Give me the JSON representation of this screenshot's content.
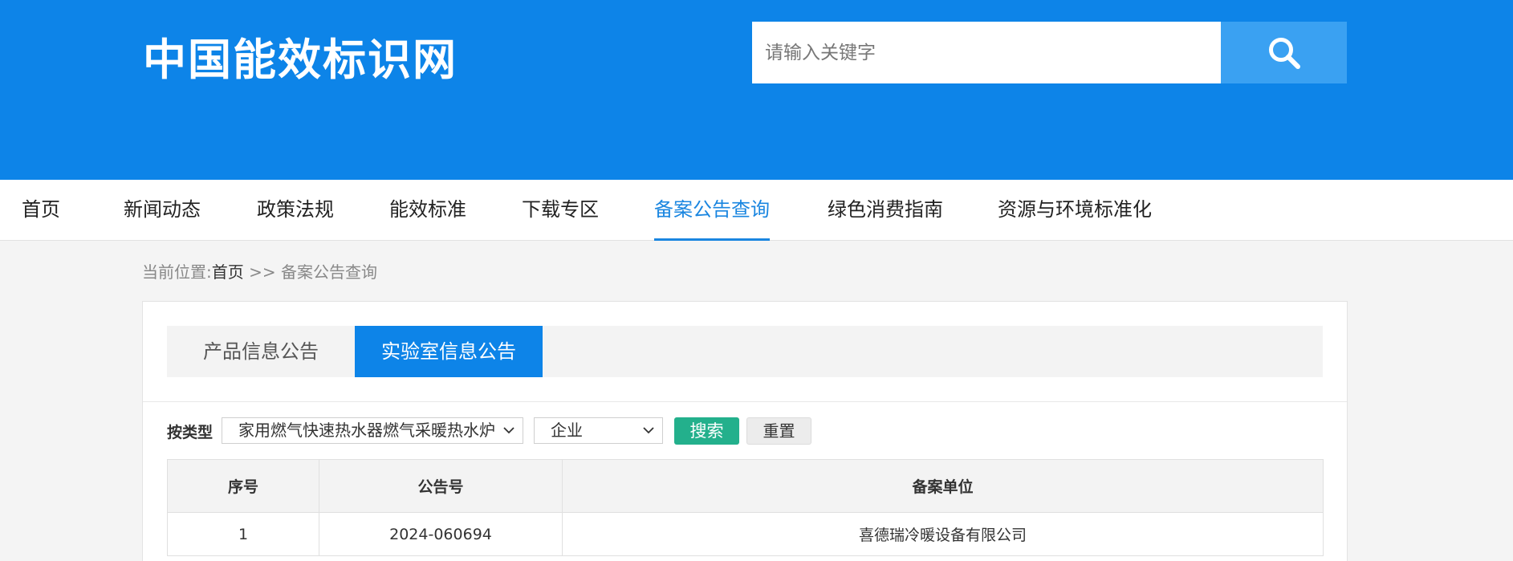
{
  "header": {
    "logo_text": "中国能效标识网",
    "search_placeholder": "请输入关键字",
    "search_icon": "search-icon",
    "background_color": "#0d84e8",
    "search_button_color": "#3aa1f2"
  },
  "nav": {
    "items": [
      {
        "label": "首页"
      },
      {
        "label": "新闻动态"
      },
      {
        "label": "政策法规"
      },
      {
        "label": "能效标准"
      },
      {
        "label": "下载专区"
      },
      {
        "label": "备案公告查询",
        "active": true
      },
      {
        "label": "绿色消费指南"
      },
      {
        "label": "资源与环境标准化"
      }
    ],
    "active_color": "#1a86e0"
  },
  "breadcrumb": {
    "prefix": "当前位置:",
    "home": "首页",
    "separator": " >> ",
    "current": "备案公告查询"
  },
  "tabs": {
    "items": [
      {
        "label": "产品信息公告",
        "active": false
      },
      {
        "label": "实验室信息公告",
        "active": true
      }
    ]
  },
  "filters": {
    "type_label": "按类型",
    "type_selected": "家用燃气快速热水器燃气采暖热水炉",
    "org_selected": "企业",
    "search_label": "搜索",
    "reset_label": "重置",
    "search_button_color": "#23b08c"
  },
  "table": {
    "columns": [
      "序号",
      "公告号",
      "备案单位"
    ],
    "rows": [
      [
        "1",
        "2024-060694",
        "喜德瑞冷暖设备有限公司"
      ]
    ]
  }
}
